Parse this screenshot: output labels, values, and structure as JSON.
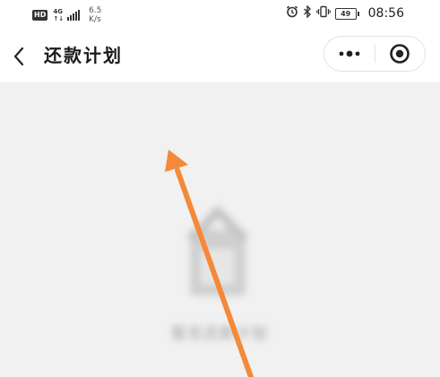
{
  "status_bar": {
    "hd": "HD",
    "network_type": "4G",
    "network_sub": "↑↓",
    "speed_value": "6.5",
    "speed_unit": "K/s",
    "icons": [
      "alarm-icon",
      "bluetooth-icon",
      "vibrate-icon"
    ],
    "battery": "49",
    "time": "08:56"
  },
  "nav": {
    "back_icon": "chevron-left-icon",
    "title": "还款计划",
    "menu_icon": "more-dots-icon",
    "close_icon": "target-circle-icon"
  },
  "main": {
    "empty_icon": "empty-box-icon",
    "empty_text": "暂无还款计划"
  },
  "annotation": {
    "type": "arrow",
    "color": "#f5893a"
  },
  "colors": {
    "background": "#f1f1f1",
    "bar": "#ffffff",
    "arrow": "#f5893a"
  }
}
